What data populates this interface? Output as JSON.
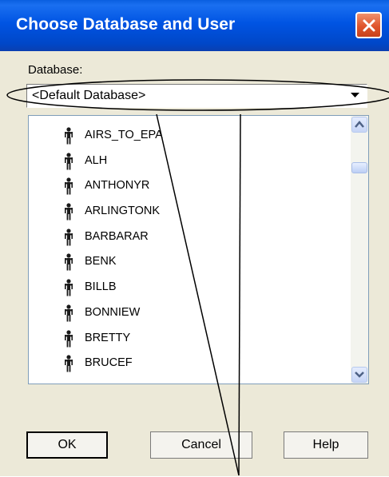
{
  "window": {
    "title": "Choose Database and User",
    "close_icon": "close-icon"
  },
  "database": {
    "label": "Database:",
    "selected": "<Default Database>",
    "dropdown_icon": "chevron-down-icon"
  },
  "users": {
    "icon": "user-icon",
    "items": [
      {
        "label": "AIRS_TO_EPA"
      },
      {
        "label": "ALH"
      },
      {
        "label": "ANTHONYR"
      },
      {
        "label": "ARLINGTONK"
      },
      {
        "label": "BARBARAR"
      },
      {
        "label": "BENK"
      },
      {
        "label": "BILLB"
      },
      {
        "label": "BONNIEW"
      },
      {
        "label": "BRETTY"
      },
      {
        "label": "BRUCEF"
      }
    ],
    "scroll_position": 0.1
  },
  "buttons": {
    "ok": "OK",
    "cancel": "Cancel",
    "help": "Help"
  },
  "colors": {
    "titlebar": "#0054e3",
    "dialog_bg": "#ece9d8",
    "close_button": "#e0552c"
  }
}
